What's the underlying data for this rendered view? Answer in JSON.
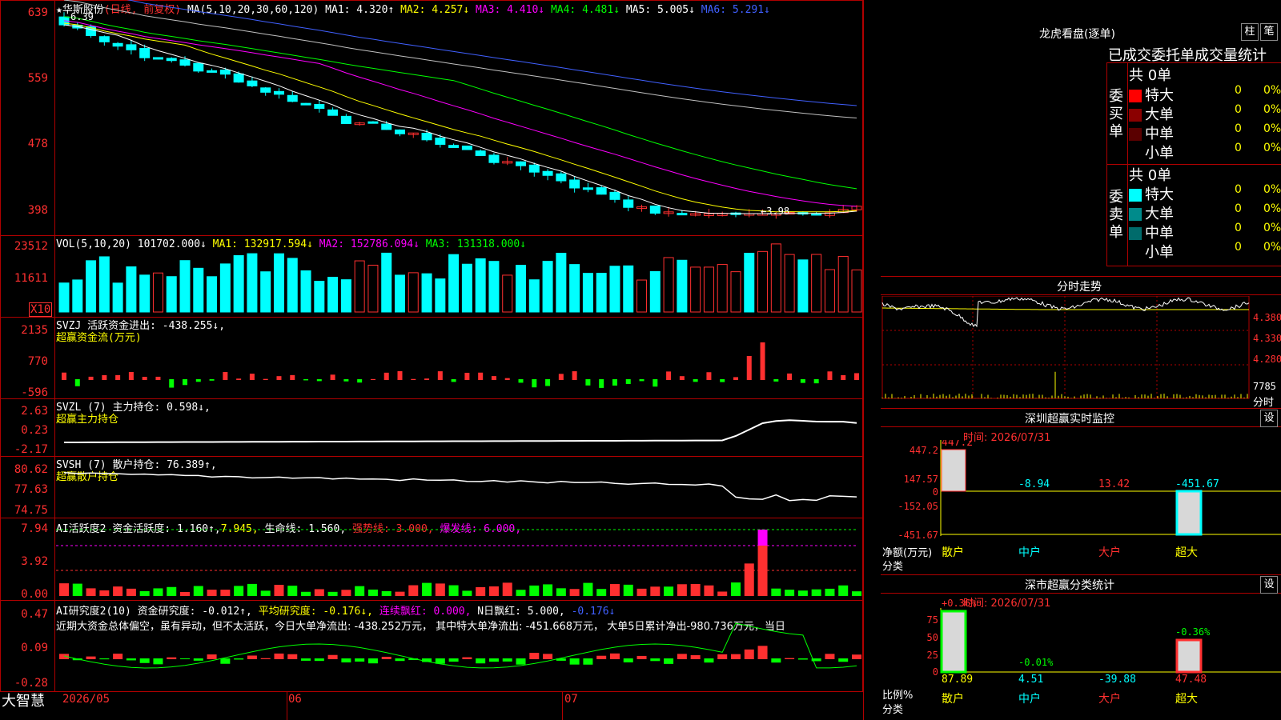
{
  "stock": {
    "name": "★华斯股份",
    "mode": "(日线, 前复权)",
    "ma_header": "MA(5,10,20,30,60,120)",
    "ma1": "MA1: 4.320↑",
    "ma2": "MA2: 4.257↓",
    "ma3": "MA3: 4.410↓",
    "ma4": "MA4: 4.481↓",
    "ma5": "MA5: 5.005↓",
    "ma6": "MA6: 5.291↓",
    "high_label": "6.39",
    "low_label": "3.98",
    "y_ticks": [
      "639",
      "559",
      "478",
      "398"
    ],
    "colors": {
      "up": "#ff3030",
      "down": "#00ffff",
      "ma1": "#ffffff",
      "ma2": "#ffff00",
      "ma3": "#ff00ff",
      "ma4": "#00ff00",
      "ma5": "#4060ff",
      "ma6": "#c0c0c0"
    }
  },
  "vol": {
    "header": "VOL(5,10,20)",
    "value": "101702.000↓",
    "ma1": "MA1: 132917.594↓",
    "ma2": "MA2: 152786.094↓",
    "ma3": "MA3: 131318.000↓",
    "y_ticks": [
      "23512",
      "11611"
    ],
    "unit": "X10"
  },
  "svzj": {
    "header": "SVZJ  活跃资金进出: -438.255↓,",
    "sub": "超赢资金流(万元)",
    "y_ticks": [
      "2135",
      "770",
      "-596"
    ]
  },
  "svzl": {
    "header": "SVZL (7) 主力持仓: 0.598↓,",
    "sub": "超赢主力持仓",
    "y_ticks": [
      "2.63",
      "0.23",
      "-2.17"
    ]
  },
  "svsh": {
    "header": "SVSH (7) 散户持仓: 76.389↑,",
    "sub": "超赢散户持仓",
    "y_ticks": [
      "80.62",
      "77.63",
      "74.75"
    ]
  },
  "ai1": {
    "header_a": "AI活跃度2 资金活跃度: 1.160↑,",
    "header_b": "7.945,",
    "header_c": "生命线: 1.560,",
    "header_d": "强势线: 3.000,",
    "header_e": "爆发线: 6.000,",
    "y_ticks": [
      "7.94",
      "3.92",
      "0.00"
    ]
  },
  "ai2": {
    "header_a": "AI研究度2(10) 资金研究度: -0.012↑,",
    "header_b": "平均研究度: -0.176↓,",
    "header_c": "连续飘红: 0.000,",
    "header_d": "N日飘红: 5.000,",
    "header_e": "-0.176↓",
    "text": "近期大资金总体偏空，虽有异动，但不太活跃，今日大单净流出: -438.252万元， 其中特大单净流出: -451.668万元， 大单5日累计净出-980.736万元，当日",
    "y_ticks": [
      "0.47",
      "0.09",
      "-0.28"
    ]
  },
  "bottom": {
    "app": "大智慧",
    "dates": [
      "2026/05",
      "06",
      "07"
    ]
  },
  "right": {
    "lhb_title": "龙虎看盘(逐单)",
    "btn1": "柱",
    "btn2": "笔",
    "stats_title": "已成交委托单成交量统计",
    "buy_label": "委买单",
    "sell_label": "委卖单",
    "buy_total": "共 0单",
    "sell_total": "共 0单",
    "buy_rows": [
      {
        "label": "特大",
        "count": "0",
        "pct": "0%",
        "color": "#ff0000"
      },
      {
        "label": "大单",
        "count": "0",
        "pct": "0%",
        "color": "#8b0000"
      },
      {
        "label": "中单",
        "count": "0",
        "pct": "0%",
        "color": "#5a0000"
      },
      {
        "label": "小单",
        "count": "0",
        "pct": "0%",
        "color": "#000000"
      }
    ],
    "sell_rows": [
      {
        "label": "特大",
        "count": "0",
        "pct": "0%",
        "color": "#00ffff"
      },
      {
        "label": "大单",
        "count": "0",
        "pct": "0%",
        "color": "#008b8b"
      },
      {
        "label": "中单",
        "count": "0",
        "pct": "0%",
        "color": "#006b6b"
      },
      {
        "label": "小单",
        "count": "0",
        "pct": "0%",
        "color": "#000000"
      }
    ],
    "intraday_title": "分时走势",
    "intraday_ticks": [
      "4.380",
      "4.330",
      "4.280"
    ],
    "intraday_vol": "7785",
    "intraday_vol_label": "分时",
    "sz_title": "深圳超赢实时监控",
    "set_label": "设",
    "sz_time": "时间: 2026/07/31",
    "sz_y": [
      "447.2",
      "147.57",
      "0",
      "-152.05",
      "-451.67"
    ],
    "sz_values": [
      "447.2",
      "-8.94",
      "13.42",
      "-451.67"
    ],
    "sz_unit": "净额(万元)",
    "sz_cat": "分类",
    "sz_cats": [
      "散户",
      "中户",
      "大户",
      "超大"
    ],
    "cls_title": "深市超赢分类统计",
    "cls_time": "时间: 2026/07/31",
    "cls_y": [
      "75",
      "50",
      "25",
      "0"
    ],
    "cls_top": [
      "+0.36%",
      "-0.01%",
      "-0.36%"
    ],
    "cls_values": [
      "87.89",
      "4.51",
      "-39.88",
      "47.48"
    ],
    "cls_unit": "比例%",
    "cls_cat": "分类",
    "cls_cats": [
      "散户",
      "中户",
      "大户",
      "超大"
    ]
  }
}
